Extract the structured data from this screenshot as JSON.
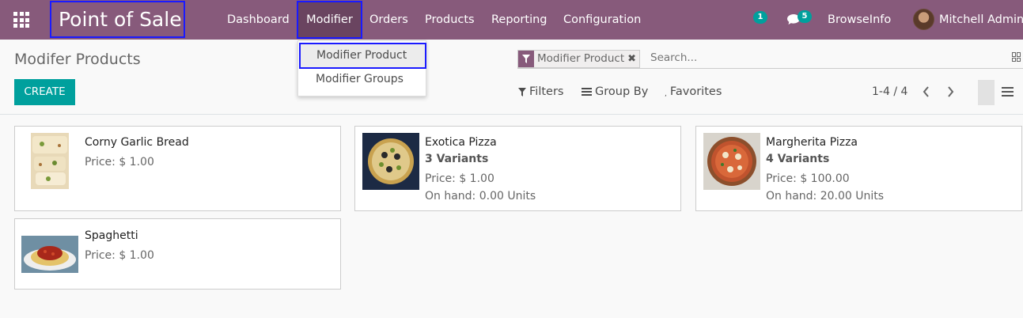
{
  "navbar": {
    "app_title": "Point of Sale",
    "menu": [
      "Dashboard",
      "Modifier",
      "Orders",
      "Products",
      "Reporting",
      "Configuration"
    ],
    "activity_count": "1",
    "message_count": "5",
    "company": "BrowseInfo",
    "user": "Mitchell Admin"
  },
  "dropdown": {
    "items": [
      "Modifier Product",
      "Modifier Groups"
    ]
  },
  "control_panel": {
    "title": "Modifer Products",
    "create_label": "CREATE",
    "search_facet": "Modifier Product",
    "search_placeholder": "Search...",
    "filters_label": "Filters",
    "groupby_label": "Group By",
    "favorites_label": "Favorites",
    "pager": "1-4 / 4"
  },
  "products": [
    {
      "name": "Corny Garlic Bread",
      "price": "Price: $ 1.00"
    },
    {
      "name": "Exotica Pizza",
      "variants": "3 Variants",
      "price": "Price: $ 1.00",
      "on_hand": "On hand: 0.00 Units"
    },
    {
      "name": "Margherita Pizza",
      "variants": "4 Variants",
      "price": "Price: $ 100.00",
      "on_hand": "On hand: 20.00 Units"
    },
    {
      "name": "Spaghetti",
      "price": "Price: $ 1.00"
    }
  ],
  "colors": {
    "navbar": "#875a7b",
    "primary_button": "#00a09d",
    "highlight_border": "#1a1aff"
  }
}
